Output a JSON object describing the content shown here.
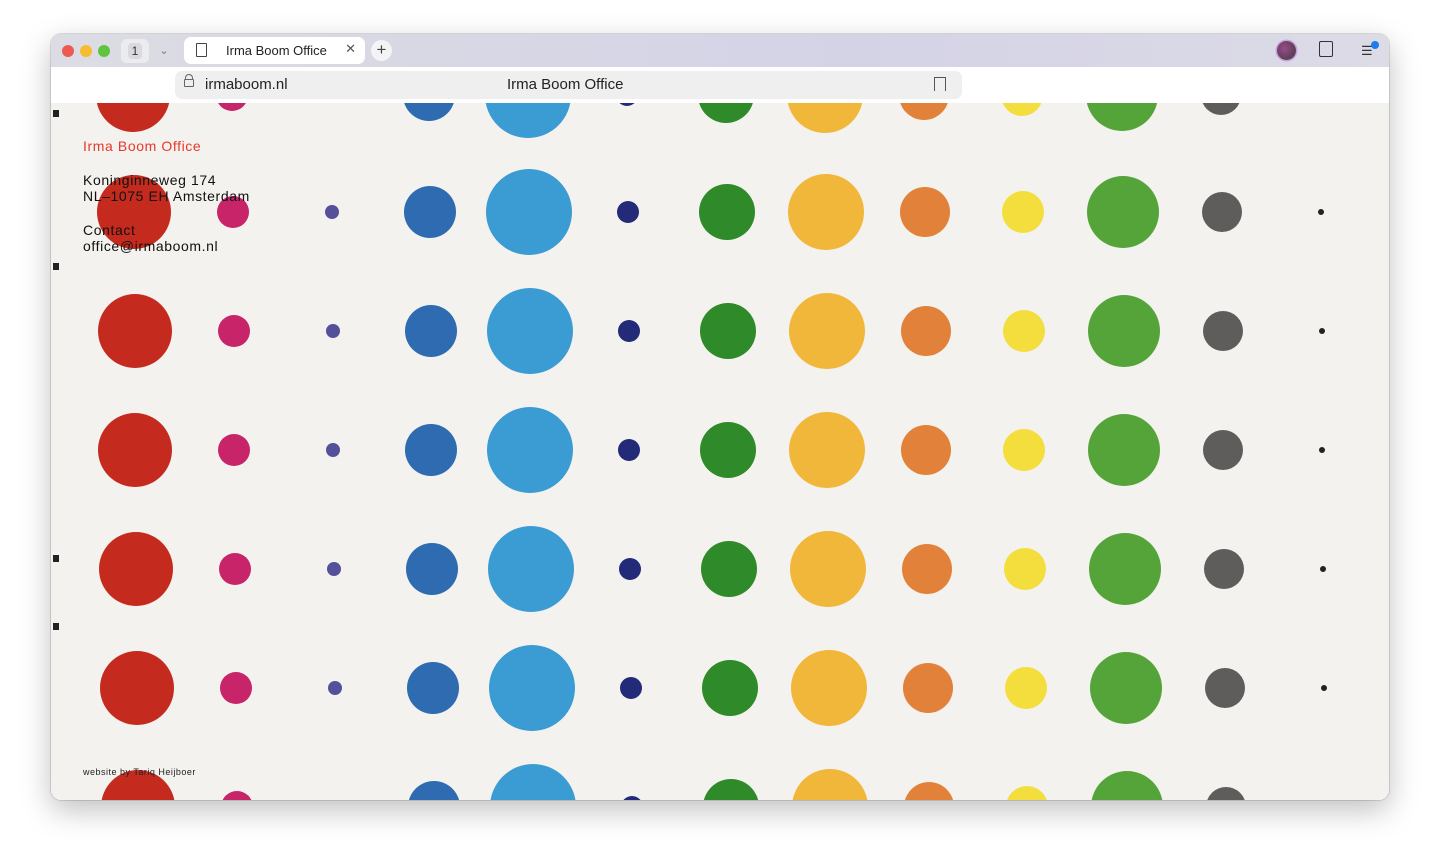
{
  "browser": {
    "tab_count": "1",
    "tab_title": "Irma Boom Office",
    "url": "irmaboom.nl",
    "page_title": "Irma Boom Office"
  },
  "site": {
    "name": "Irma Boom Office",
    "address_line1": "Koninginneweg 174",
    "address_line2": "NL–1075 EH Amsterdam",
    "contact_label": "Contact",
    "email": "office@irmaboom.nl",
    "credit": "website by Tariq Heijboer",
    "accent_color": "#e8382b"
  },
  "dot_palette": [
    "#c42b1e",
    "#c8246a",
    "#55509a",
    "#2f6bb0",
    "#3b9bd3",
    "#232a78",
    "#2f8a2a",
    "#f1b73a",
    "#e2823a",
    "#f3de3e",
    "#55a43a",
    "#5f5d5c",
    "#222222"
  ]
}
